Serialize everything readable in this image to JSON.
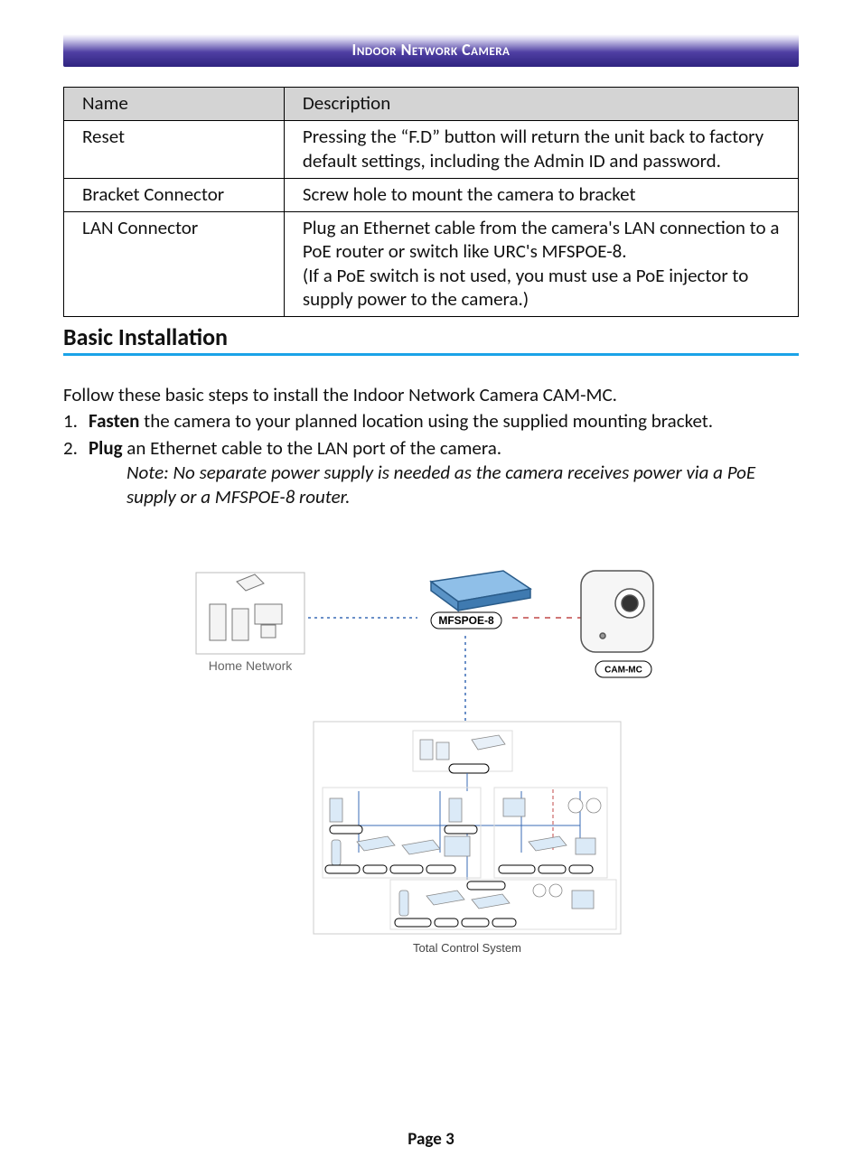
{
  "header": {
    "title": "Indoor Network Camera"
  },
  "table": {
    "headers": {
      "name": "Name",
      "description": "Description"
    },
    "rows": [
      {
        "name": "Reset",
        "description": "Pressing the “F.D” button will return the unit back to factory default settings, including the Admin ID and password."
      },
      {
        "name": "Bracket Connector",
        "description": "Screw hole to mount the camera to bracket"
      },
      {
        "name": "LAN Connector",
        "description": "Plug an Ethernet cable from the camera's LAN connection to a PoE router or switch like URC's MFSPOE-8.\n(If a PoE switch is not used, you must use a PoE injector to supply power to the camera.)"
      }
    ]
  },
  "section": {
    "title": "Basic Installation"
  },
  "intro": "Follow these basic steps to install the Indoor Network Camera CAM-MC.",
  "steps": [
    {
      "num": "1.",
      "bold": "Fasten",
      "rest": " the camera to your planned location using the supplied mounting bracket."
    },
    {
      "num": "2.",
      "bold": "Plug",
      "rest": " an Ethernet cable to the LAN port of the camera."
    }
  ],
  "note": "Note: No separate power supply is needed as the camera receives power via a PoE supply or a MFSPOE-8 router.",
  "diagram": {
    "home_network": "Home Network",
    "mfspoe": "MFSPOE-8",
    "cam_mc": "CAM-MC",
    "caption": "Total Control System"
  },
  "footer": {
    "page": "Page 3"
  }
}
